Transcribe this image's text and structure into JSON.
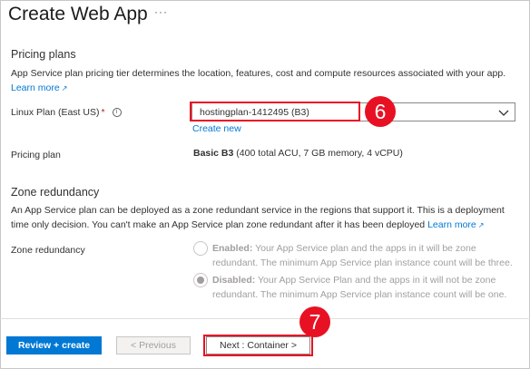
{
  "header": {
    "title": "Create Web App",
    "more": "···"
  },
  "pricing": {
    "heading": "Pricing plans",
    "description": "App Service plan pricing tier determines the location, features, cost and compute resources associated with your app.",
    "learn_more": "Learn more",
    "linux_plan_label": "Linux Plan (East US)",
    "required_mark": "*",
    "info_glyph": "i",
    "linux_plan_value": "hostingplan-1412495 (B3)",
    "create_new": "Create new",
    "pricing_plan_label": "Pricing plan",
    "pricing_plan_name": "Basic B3",
    "pricing_plan_detail": " (400 total ACU, 7 GB memory, 4 vCPU)"
  },
  "zone": {
    "heading": "Zone redundancy",
    "description": "An App Service plan can be deployed as a zone redundant service in the regions that support it. This is a deployment time only decision. You can't make an App Service plan zone redundant after it has been deployed",
    "learn_more": "Learn more",
    "label": "Zone redundancy",
    "enabled_title": "Enabled:",
    "enabled_text": " Your App Service plan and the apps in it will be zone redundant. The minimum App Service plan instance count will be three.",
    "disabled_title": "Disabled:",
    "disabled_text": " Your App Service Plan and the apps in it will not be zone redundant. The minimum App Service plan instance count will be one.",
    "selected": "disabled"
  },
  "footer": {
    "review_create": "Review + create",
    "previous": "< Previous",
    "next": "Next : Container >"
  },
  "annotations": {
    "step6": "6",
    "step7": "7"
  },
  "colors": {
    "accent": "#0078d4",
    "annotation": "#e81123",
    "required": "#a4262c"
  },
  "icons": [
    "more-icon",
    "external-link-icon",
    "info-icon",
    "chevron-down-icon"
  ]
}
